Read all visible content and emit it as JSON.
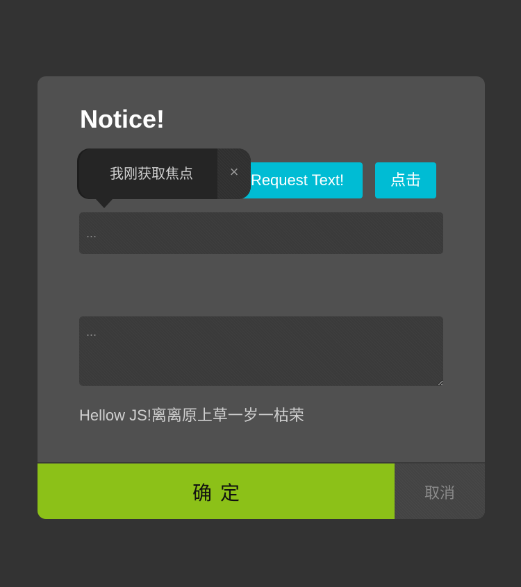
{
  "dialog": {
    "title": "Notice!",
    "buttons": {
      "request_label": "Request Text!",
      "click_label": "点击"
    },
    "input": {
      "value": "",
      "placeholder": "..."
    },
    "textarea": {
      "value": "",
      "placeholder": "..."
    },
    "body_text": "Hellow JS!离离原上草一岁一枯荣",
    "footer": {
      "ok_label": "确定",
      "cancel_label": "取消"
    }
  },
  "tooltip": {
    "text": "我刚获取焦点",
    "close_icon": "×"
  },
  "colors": {
    "background": "#333333",
    "dialog": "#505050",
    "accent_cyan": "#00bcd4",
    "confirm_green": "#8cc118"
  },
  "icons": {
    "close": "close-icon"
  }
}
